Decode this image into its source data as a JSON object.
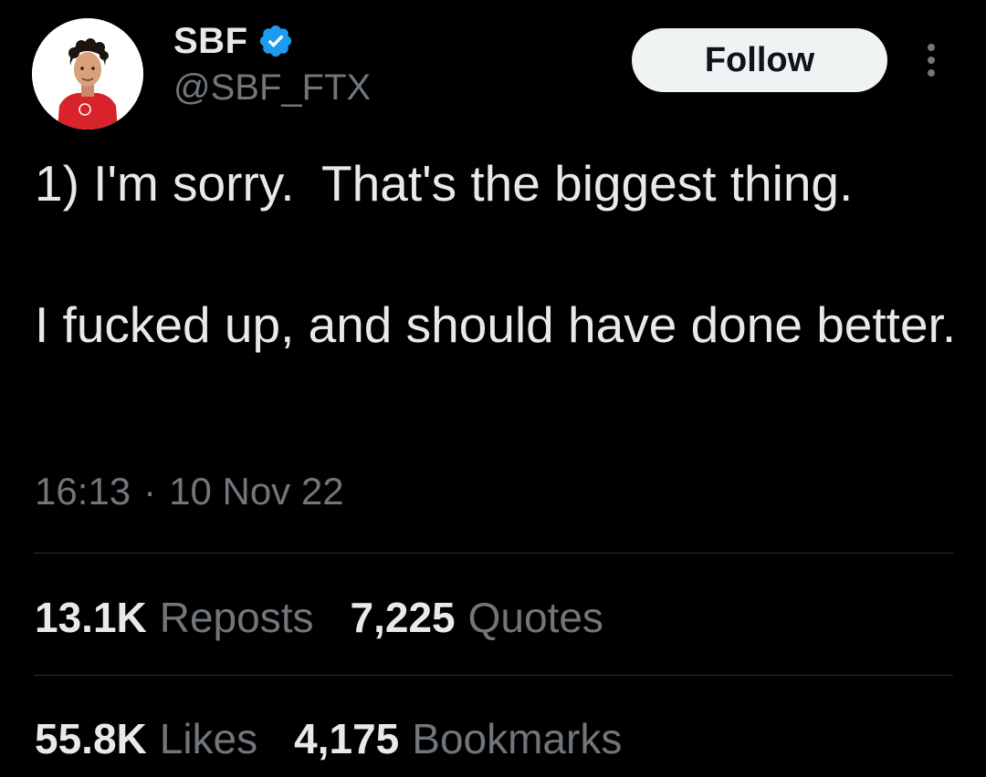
{
  "author": {
    "display_name": "SBF",
    "handle": "@SBF_FTX",
    "verified": true,
    "avatar_icon": "profile-photo"
  },
  "follow_label": "Follow",
  "more_icon": "more-vertical-icon",
  "tweet": {
    "paragraphs": [
      "1) I'm sorry.  That's the biggest thing.",
      "I fucked up, and should have done better."
    ],
    "time": "16:13",
    "separator": "·",
    "date": "10 Nov 22"
  },
  "stats": {
    "reposts": {
      "count": "13.1K",
      "label": "Reposts"
    },
    "quotes": {
      "count": "7,225",
      "label": "Quotes"
    },
    "likes": {
      "count": "55.8K",
      "label": "Likes"
    },
    "bookmarks": {
      "count": "4,175",
      "label": "Bookmarks"
    }
  },
  "colors": {
    "background": "#000000",
    "primary_text": "#e7e9ea",
    "secondary_text": "#71767b",
    "divider": "#2f3336",
    "verified_blue": "#1d9bf0",
    "follow_bg": "#eff3f4"
  }
}
